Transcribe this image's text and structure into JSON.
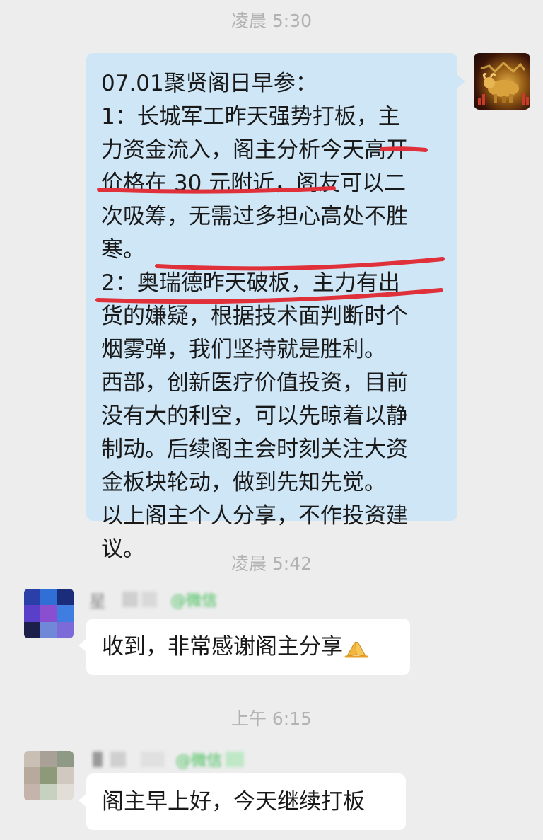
{
  "timestamps": [
    "凌晨 5:30",
    "凌晨 5:42",
    "上午 6:15"
  ],
  "messages": {
    "self": {
      "lines": [
        "07.01聚贤阁日早参：",
        "1：长城军工昨天强势打板，主",
        "力资金流入，阁主分析今天高开",
        "价格在 30 元附近，阁友可以二",
        "次吸筹，无需过多担心高处不胜",
        "寒。",
        "2：奥瑞德昨天破板，主力有出",
        "货的嫌疑，根据技术面判断时个",
        "烟雾弹，我们坚持就是胜利。",
        "西部，创新医疗价值投资，目前",
        "没有大的利空，可以先晾着以静",
        "制动。后续阁主会时刻关注大资",
        "金板块轮动，做到先知先觉。",
        "以上阁主个人分享，不作投资建",
        "议。"
      ]
    },
    "reply1": {
      "sender": "星",
      "sender_suffix": "@微信",
      "text": "收到，非常感谢阁主分享"
    },
    "reply2": {
      "sender": "",
      "sender_suffix": "@微信",
      "text": "阁主早上好，今天继续打板"
    }
  },
  "icons": {
    "self_avatar": "golden-bull-avatar-icon",
    "reply1_avatar": "pixelated-avatar-icon",
    "reply2_avatar": "pixelated-avatar-icon",
    "emoji": "folded-hands-emoji-icon"
  },
  "colors": {
    "background": "#ededed",
    "self_bubble": "#cfe6f7",
    "other_bubble": "#ffffff",
    "timestamp": "#b2b2b2",
    "annotation": "#e0303a",
    "wechat_tag": "#3bbd53"
  }
}
